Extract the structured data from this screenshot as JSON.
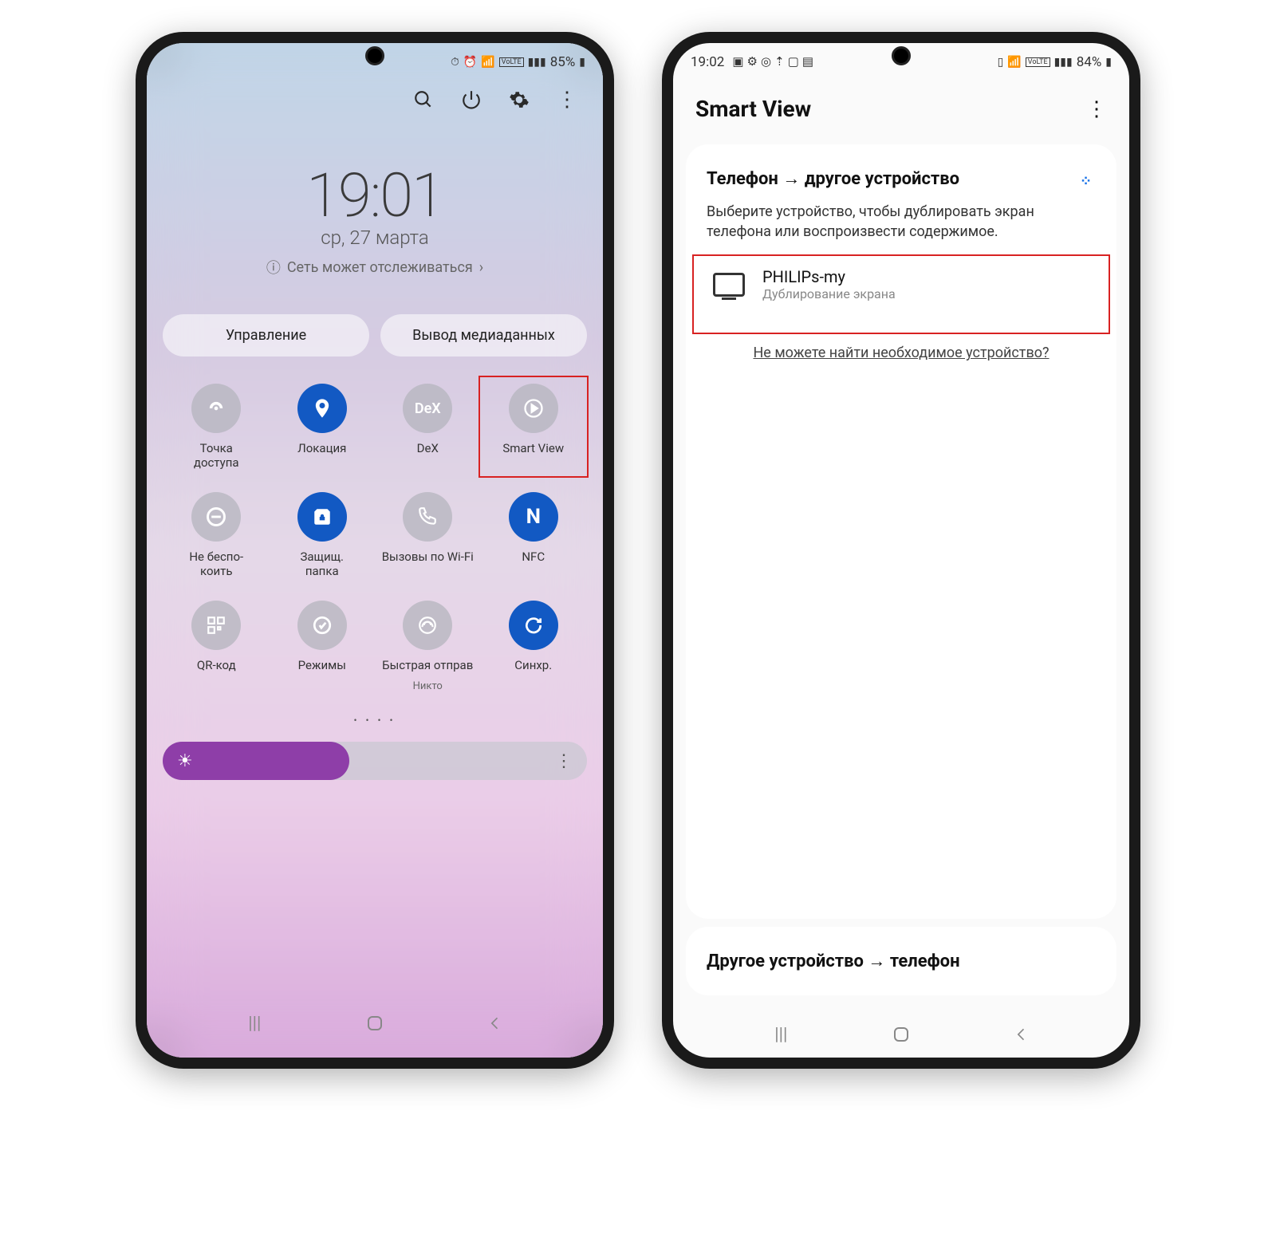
{
  "left": {
    "status": {
      "battery": "85%",
      "net_label": "VoLTE"
    },
    "time": "19:01",
    "date": "ср, 27 марта",
    "network_note": "Сеть может отслеживаться",
    "tabs": {
      "manage": "Управление",
      "media_output": "Вывод медиаданных"
    },
    "tiles": [
      {
        "icon": "wifi-tether",
        "label": "Точка\nдоступа",
        "active": false
      },
      {
        "icon": "location",
        "label": "Локация",
        "active": true
      },
      {
        "icon": "dex",
        "label": "DeX",
        "active": false
      },
      {
        "icon": "smartview",
        "label": "Smart View",
        "active": false,
        "highlight": true
      },
      {
        "icon": "dnd",
        "label": "Не беспо-\nкоить",
        "active": false
      },
      {
        "icon": "secure-folder",
        "label": "Защищ.\nпапка",
        "active": true
      },
      {
        "icon": "wifi-call",
        "label": "Вызовы по Wi-Fi",
        "active": false
      },
      {
        "icon": "nfc",
        "label": "NFC",
        "active": true
      },
      {
        "icon": "qr",
        "label": "QR-код",
        "active": false
      },
      {
        "icon": "modes",
        "label": "Режимы",
        "active": false
      },
      {
        "icon": "quickshare",
        "label": "Быстрая отправ",
        "sublabel": "Никто",
        "active": false
      },
      {
        "icon": "sync",
        "label": "Синхр.",
        "active": true
      }
    ]
  },
  "right": {
    "status": {
      "time": "19:02",
      "battery": "84%",
      "net_label": "VoLTE"
    },
    "title": "Smart View",
    "direction": "Телефон → другое устройство",
    "hint": "Выберите устройство, чтобы дублировать экран телефона или воспроизвести содержимое.",
    "device": {
      "name": "PHILIPs-my",
      "subtitle": "Дублирование экрана"
    },
    "cant_find": "Не можете найти необходимое устройство?",
    "reverse": "Другое устройство → телефон"
  }
}
